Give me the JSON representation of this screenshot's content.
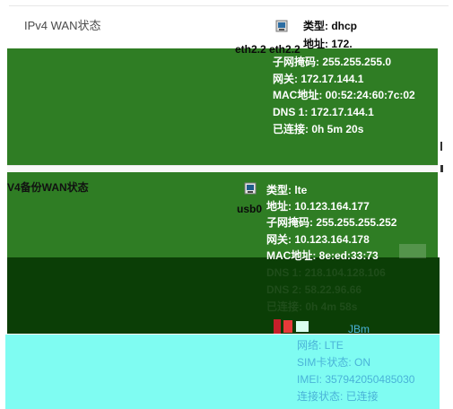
{
  "wan": {
    "title": "IPv4 WAN状态",
    "interface": "eth2.2 eth2.2",
    "rows": [
      "类型: dhcp",
      "地址: 172.",
      "子网掩码: 255.255.255.0",
      "网关: 172.17.144.1",
      "MAC地址: 00:52:24:60:7c:02",
      "DNS 1: 172.17.144.1",
      "已连接: 0h 5m 20s"
    ]
  },
  "backup": {
    "title": "V4备份WAN状态",
    "interface": "usb0",
    "rows": [
      "类型: lte",
      "地址: 10.123.164.177",
      "子网掩码: 255.255.255.252",
      "网关: 10.123.164.178",
      "MAC地址: 8e:ed:33:73",
      "DNS 1: 218.104.128.106",
      "DNS 2: 58.22.96.66",
      "已连接: 0h 4m 58s",
      "JBm",
      "网络: LTE",
      "SIM卡状态: ON",
      "IMEI: 357942050485030",
      "连接状态: 已连接"
    ]
  },
  "icons": {
    "wan_icon": "network-port-icon",
    "backup_icon": "usb-modem-icon"
  },
  "colors": {
    "green": "#2f7d24",
    "dark_green": "#0b3e06",
    "cyan": "#7ffcf2"
  }
}
